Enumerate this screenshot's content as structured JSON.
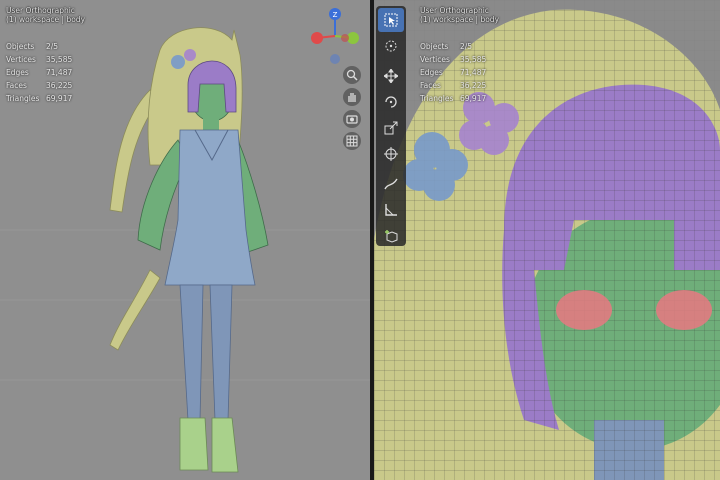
{
  "left_viewport": {
    "view_name": "User Orthographic",
    "collection": "(1) workspace | body",
    "stats": [
      {
        "label": "Objects",
        "value": "2/5"
      },
      {
        "label": "Vertices",
        "value": "35,585"
      },
      {
        "label": "Edges",
        "value": "71,487"
      },
      {
        "label": "Faces",
        "value": "36,225"
      },
      {
        "label": "Triangles",
        "value": "69,917"
      }
    ],
    "gizmo_axis_label": "Z"
  },
  "right_viewport": {
    "view_name": "User Orthographic",
    "collection": "(1) workspace | body",
    "stats": [
      {
        "label": "Objects",
        "value": "2/5"
      },
      {
        "label": "Vertices",
        "value": "35,585"
      },
      {
        "label": "Edges",
        "value": "71,487"
      },
      {
        "label": "Faces",
        "value": "36,225"
      },
      {
        "label": "Triangles",
        "value": "69,917"
      }
    ]
  },
  "nav_icons": [
    "zoom-icon",
    "hand-pan-icon",
    "camera-icon",
    "grid-icon"
  ],
  "tools": [
    "select-box",
    "cursor",
    "move",
    "rotate",
    "scale",
    "transform",
    "annotate",
    "measure",
    "add-cube"
  ],
  "colors": {
    "hair": "#c9c98a",
    "hair_purple": "#9b7cc7",
    "skin": "#6fae7a",
    "dress": "#8fa8c8",
    "tights": "#7f96b8",
    "shoes": "#a9d18b",
    "flower_blue": "#7f9ec4",
    "flower_purple": "#a98ac8",
    "active_tool": "#4772b3"
  }
}
